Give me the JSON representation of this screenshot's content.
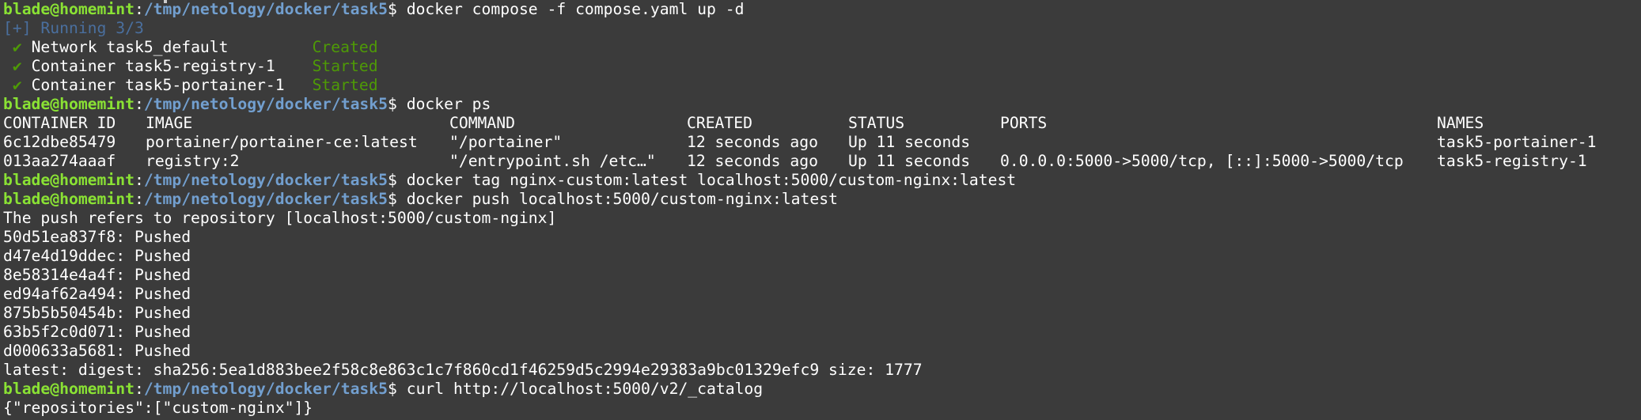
{
  "prompt": {
    "user": "blade@homemint",
    "colon": ":",
    "path": "/tmp/netology/docker/task5",
    "dollar": "$"
  },
  "commands": {
    "compose_up": " docker compose -f compose.yaml up -d",
    "ps": " docker ps",
    "tag": " docker tag nginx-custom:latest localhost:5000/custom-nginx:latest",
    "push": " docker push localhost:5000/custom-nginx:latest",
    "curl": " curl http://localhost:5000/v2/_catalog"
  },
  "compose_output": {
    "running": "[+] Running 3/3",
    "check_mark": "✔",
    "items": [
      {
        "name": "Network task5_default",
        "status": "Created"
      },
      {
        "name": "Container task5-registry-1",
        "status": "Started"
      },
      {
        "name": "Container task5-portainer-1",
        "status": "Started"
      }
    ]
  },
  "ps_table": {
    "headers": [
      "CONTAINER ID",
      "IMAGE",
      "COMMAND",
      "CREATED",
      "STATUS",
      "PORTS",
      "NAMES"
    ],
    "rows": [
      [
        "6c12dbe85479",
        "portainer/portainer-ce:latest",
        "\"/portainer\"",
        "12 seconds ago",
        "Up 11 seconds",
        "",
        "task5-portainer-1"
      ],
      [
        "013aa274aaaf",
        "registry:2",
        "\"/entrypoint.sh /etc…\"",
        "12 seconds ago",
        "Up 11 seconds",
        "0.0.0.0:5000->5000/tcp, [::]:5000->5000/tcp",
        "task5-registry-1"
      ]
    ]
  },
  "push_output": {
    "refers": "The push refers to repository [localhost:5000/custom-nginx]",
    "layers": [
      "50d51ea837f8: Pushed",
      "d47e4d19ddec: Pushed",
      "8e58314e4a4f: Pushed",
      "ed94af62a494: Pushed",
      "875b5b50454b: Pushed",
      "63b5f2c0d071: Pushed",
      "d000633a5681: Pushed"
    ],
    "digest": "latest: digest: sha256:5ea1d883bee2f58c8e863c1c7f860cd1f46259d5c2994e29383a9bc01329efc9 size: 1777"
  },
  "curl_output": "{\"repositories\":[\"custom-nginx\"]}",
  "colors": {
    "background": "#3b3b3b",
    "user_green": "#8ae234",
    "path_blue": "#729fcf",
    "status_green": "#4e9a06"
  }
}
